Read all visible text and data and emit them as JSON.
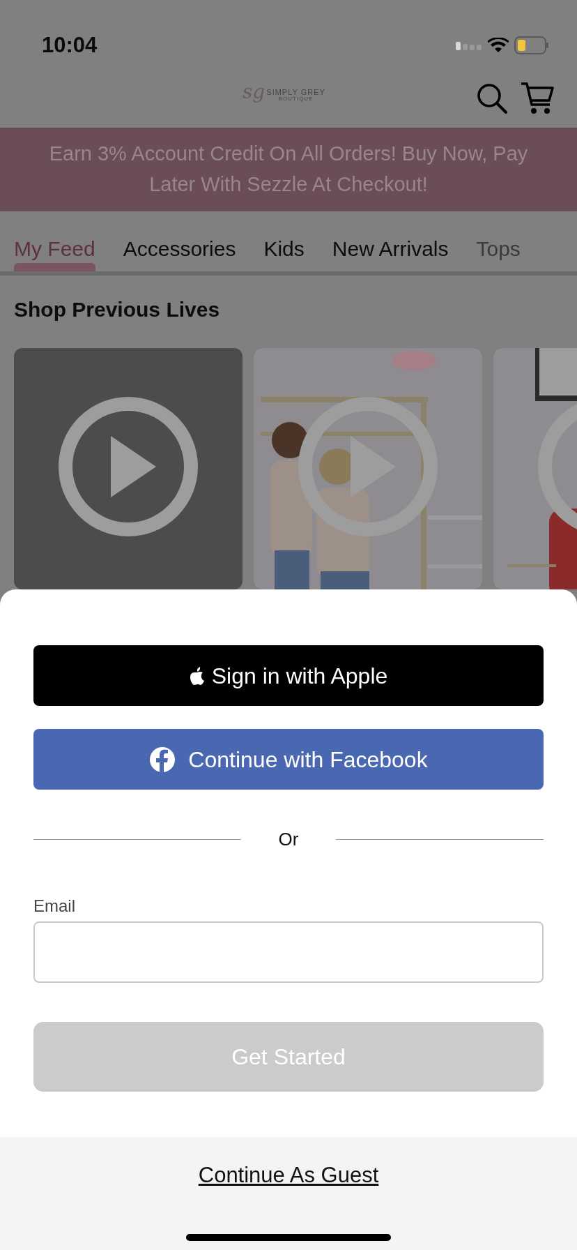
{
  "status_bar": {
    "time": "10:04"
  },
  "header": {
    "logo": {
      "script": "sg",
      "name": "SIMPLY GREY",
      "tagline": "BOUTIQUE"
    }
  },
  "banner": {
    "text": "Earn 3% Account Credit On All Orders! Buy Now, Pay Later With Sezzle At Checkout!"
  },
  "tabs": [
    {
      "label": "My Feed",
      "selected": true
    },
    {
      "label": "Accessories",
      "selected": false
    },
    {
      "label": "Kids",
      "selected": false
    },
    {
      "label": "New Arrivals",
      "selected": false
    },
    {
      "label": "Tops",
      "selected": false
    }
  ],
  "section_title": "Shop Previous Lives",
  "lives": [
    {
      "kind": "placeholder"
    },
    {
      "kind": "picture"
    },
    {
      "kind": "picture"
    }
  ],
  "sheet": {
    "apple_button": "Sign in with Apple",
    "facebook_button": "Continue with Facebook",
    "divider_text": "Or",
    "email": {
      "label": "Email"
    },
    "submit": {
      "label": "Get Started",
      "disabled": true
    },
    "guest_link": "Continue As Guest"
  }
}
